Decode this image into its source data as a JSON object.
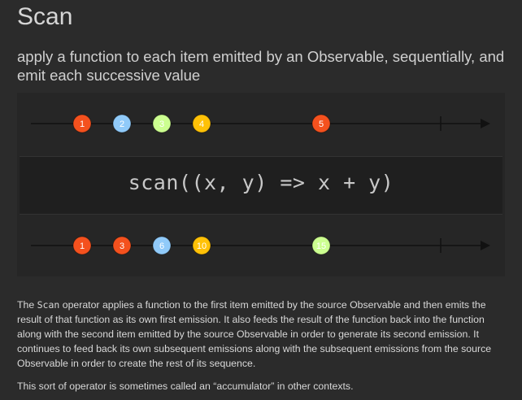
{
  "title": "Scan",
  "subtitle": "apply a function to each item emitted by an Observable, sequentially, and emit each successive value",
  "operator_label": "scan((x, y) => x + y)",
  "description": {
    "pre": "The ",
    "code": "Scan",
    "post": " operator applies a function to the first item emitted by the source Observable and then emits the result of that function as its own first emission. It also feeds the result of the function back into the function along with the second item emitted by the source Observable in order to generate its second emission. It continues to feed back its own subsequent emissions along with the subsequent emissions from the source Observable in order to create the rest of its sequence."
  },
  "note": "This sort of operator is sometimes called an “accumulator” in other contexts.",
  "chart_data": {
    "type": "marble",
    "input": [
      {
        "label": "1",
        "t": 1,
        "color": "#f4511e"
      },
      {
        "label": "2",
        "t": 2,
        "color": "#90caf9"
      },
      {
        "label": "3",
        "t": 3,
        "color": "#ccff90"
      },
      {
        "label": "4",
        "t": 4,
        "color": "#ffc107"
      },
      {
        "label": "5",
        "t": 7,
        "color": "#f4511e"
      }
    ],
    "output": [
      {
        "label": "1",
        "t": 1,
        "color": "#f4511e"
      },
      {
        "label": "3",
        "t": 2,
        "color": "#f4511e"
      },
      {
        "label": "6",
        "t": 3,
        "color": "#90caf9"
      },
      {
        "label": "10",
        "t": 4,
        "color": "#ffc107"
      },
      {
        "label": "15",
        "t": 7,
        "color": "#ccff90"
      }
    ],
    "completion_t": 10,
    "line_color": "#111111",
    "label_color": "#ffffff"
  }
}
